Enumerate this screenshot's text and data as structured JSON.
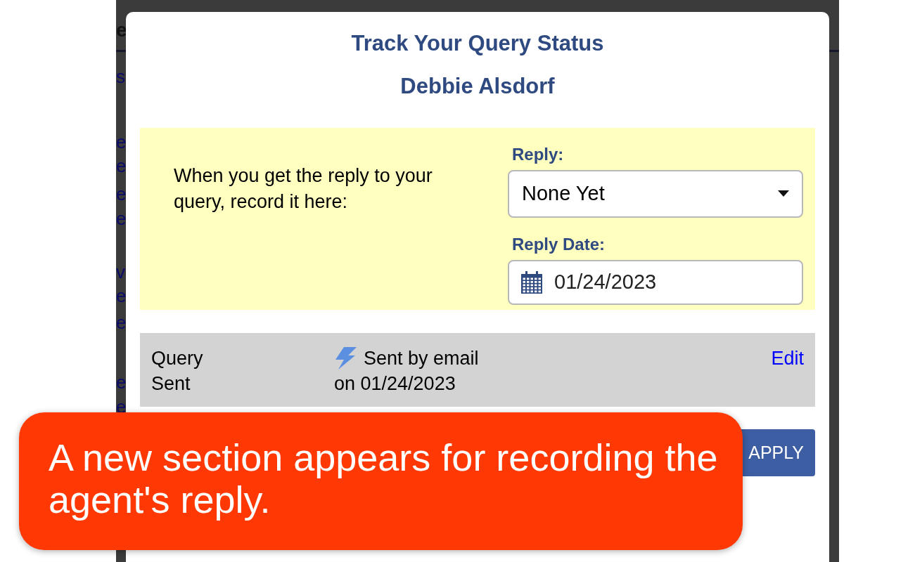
{
  "background": {
    "header": [
      "e"
    ],
    "side_letters": [
      "s",
      "e",
      "e",
      "e",
      "e",
      "v",
      "e",
      "e",
      "e",
      "e"
    ]
  },
  "dialog": {
    "title": "Track Your Query Status",
    "subtitle": "Debbie Alsdorf",
    "reply_section": {
      "instruction": "When you get the reply to your query, record it here:",
      "reply_label": "Reply:",
      "reply_value": "None Yet",
      "date_label": "Reply Date:",
      "date_value": "01/24/2023"
    },
    "sent_row": {
      "label": "Query Sent",
      "status_line": "Sent by email",
      "date_line": "on 01/24/2023",
      "edit": "Edit"
    },
    "apply_button": "APPLY"
  },
  "callout": "A new section appears for recording the agent's reply."
}
